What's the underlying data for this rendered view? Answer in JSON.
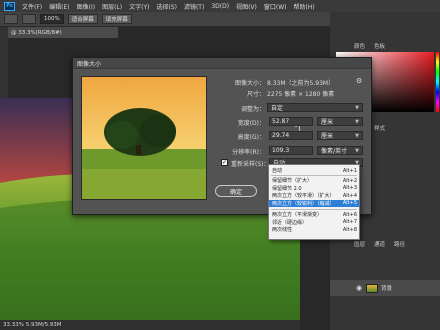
{
  "menubar": {
    "logo": "Ps",
    "items": [
      "文件(F)",
      "编辑(E)",
      "图像(I)",
      "图层(L)",
      "文字(Y)",
      "选择(S)",
      "滤镜(T)",
      "3D(D)",
      "视图(V)",
      "窗口(W)",
      "帮助(H)"
    ]
  },
  "optbar": {
    "zoom": "100%",
    "fit_screen": "适合屏幕",
    "fill_screen": "填充屏幕"
  },
  "doc_tab": "@ 33.3%(RGB/8#)",
  "status": "33.33%    5.93M/5.93M",
  "right_panel": {
    "layers_label": "背景",
    "tab_labels": [
      "颜色",
      "色板",
      "调整",
      "样式",
      "图层",
      "通道",
      "路径"
    ]
  },
  "dialog": {
    "title": "图像大小",
    "image_size_label": "图像大小：",
    "image_size_value": "8.33M（之前为5.93M）",
    "dimensions_label": "尺寸：",
    "dimensions_value": "2275 像素 × 1280 像素",
    "fit_to_label": "调整为：",
    "fit_to_value": "自定",
    "width_label": "宽度(D)：",
    "width_value": "52.87",
    "width_unit": "厘米",
    "height_label": "高度(G)：",
    "height_value": "29.74",
    "height_unit": "厘米",
    "resolution_label": "分辨率(R)：",
    "resolution_value": "109.3",
    "resolution_unit": "像素/英寸",
    "resample_label": "重新采样(S)：",
    "resample_value": "自动",
    "resample_checked": "✓",
    "ok_label": "确定",
    "gear": "⚙"
  },
  "dropdown": {
    "items": [
      {
        "label": "自动",
        "shortcut": "Alt+1",
        "highlighted": false
      },
      {
        "label": "保留细节（扩大）",
        "shortcut": "Alt+2",
        "highlighted": false
      },
      {
        "label": "保留细节 2.0",
        "shortcut": "Alt+3",
        "highlighted": false
      },
      {
        "label": "两次立方（较平滑）（扩大）",
        "shortcut": "Alt+4",
        "highlighted": false
      },
      {
        "label": "两次立方（较锐利）（缩减）",
        "shortcut": "Alt+5",
        "highlighted": true
      },
      {
        "label": "两次立方（平滑渐变）",
        "shortcut": "Alt+6",
        "highlighted": false
      },
      {
        "label": "邻近（硬边缘）",
        "shortcut": "Alt+7",
        "highlighted": false
      },
      {
        "label": "两次线性",
        "shortcut": "Alt+8",
        "highlighted": false
      }
    ]
  }
}
